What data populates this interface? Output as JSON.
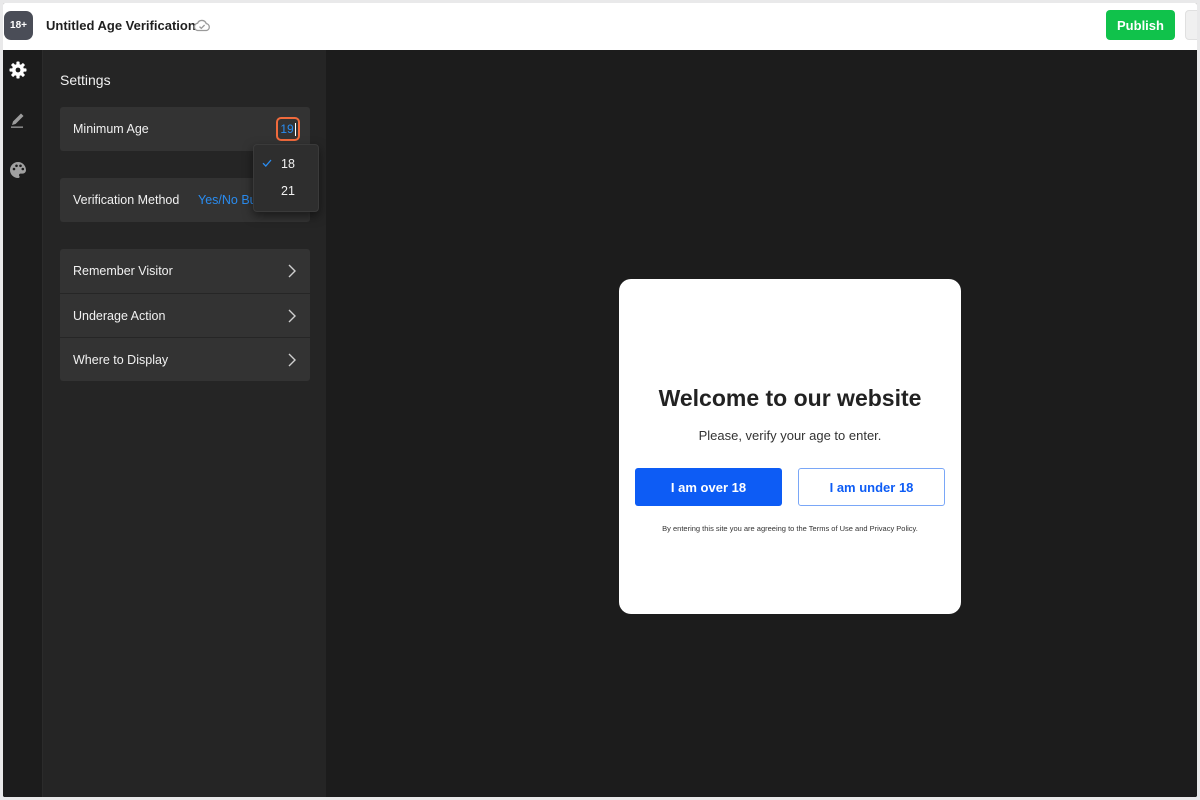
{
  "header": {
    "logo_text": "18+",
    "title": "Untitled Age Verification",
    "publish_label": "Publish",
    "publish_color": "#10c24b"
  },
  "rail": {
    "icons": [
      "gear-icon",
      "pencil-icon",
      "palette-icon"
    ]
  },
  "settings": {
    "title": "Settings",
    "minimum_age": {
      "label": "Minimum Age",
      "value": "19"
    },
    "age_options": [
      {
        "value": "18",
        "selected": true
      },
      {
        "value": "21",
        "selected": false
      }
    ],
    "verification_method": {
      "label": "Verification Method",
      "value": "Yes/No Bu"
    },
    "nav_items": [
      {
        "label": "Remember Visitor"
      },
      {
        "label": "Underage Action"
      },
      {
        "label": "Where to Display"
      }
    ]
  },
  "preview": {
    "title": "Welcome to our website",
    "subtitle": "Please, verify your age to enter.",
    "over_button": "I am over 18",
    "under_button": "I am under 18",
    "disclaimer": "By entering this site you are agreeing to the Terms of Use and Privacy Policy.",
    "accent_color": "#0d5cf5"
  }
}
